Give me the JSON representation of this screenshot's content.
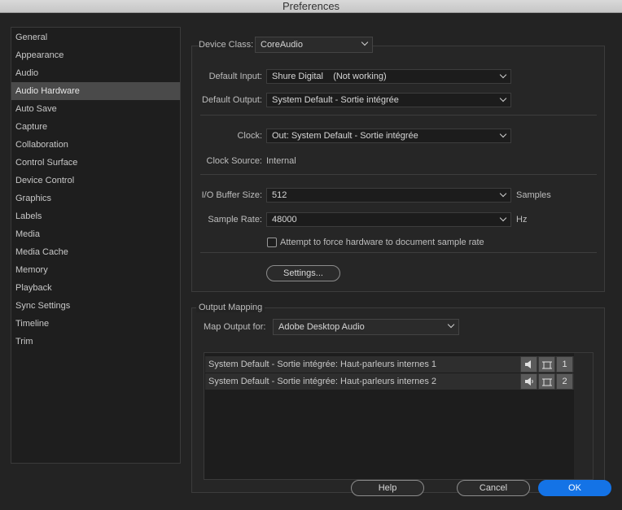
{
  "window": {
    "title": "Preferences"
  },
  "sidebar": {
    "items": [
      {
        "label": "General"
      },
      {
        "label": "Appearance"
      },
      {
        "label": "Audio"
      },
      {
        "label": "Audio Hardware"
      },
      {
        "label": "Auto Save"
      },
      {
        "label": "Capture"
      },
      {
        "label": "Collaboration"
      },
      {
        "label": "Control Surface"
      },
      {
        "label": "Device Control"
      },
      {
        "label": "Graphics"
      },
      {
        "label": "Labels"
      },
      {
        "label": "Media"
      },
      {
        "label": "Media Cache"
      },
      {
        "label": "Memory"
      },
      {
        "label": "Playback"
      },
      {
        "label": "Sync Settings"
      },
      {
        "label": "Timeline"
      },
      {
        "label": "Trim"
      }
    ],
    "selected": "Audio Hardware"
  },
  "device": {
    "class_label": "Device Class:",
    "class_value": "CoreAudio",
    "default_input_label": "Default Input:",
    "default_input_value": "Shure Digital    (Not working)",
    "default_output_label": "Default Output:",
    "default_output_value": "System Default - Sortie intégrée",
    "clock_label": "Clock:",
    "clock_value": "Out: System Default - Sortie intégrée",
    "clock_source_label": "Clock Source:",
    "clock_source_value": "Internal",
    "buffer_label": "I/O Buffer Size:",
    "buffer_value": "512",
    "buffer_unit": "Samples",
    "sample_rate_label": "Sample Rate:",
    "sample_rate_value": "48000",
    "sample_rate_unit": "Hz",
    "force_rate_label": "Attempt to force hardware to document sample rate",
    "force_rate_checked": false,
    "settings_button": "Settings..."
  },
  "output_mapping": {
    "group_label": "Output Mapping",
    "map_for_label": "Map Output for:",
    "map_for_value": "Adobe Desktop Audio",
    "rows": [
      {
        "name": "System Default - Sortie intégrée: Haut-parleurs internes 1",
        "channel": "1"
      },
      {
        "name": "System Default - Sortie intégrée: Haut-parleurs internes 2",
        "channel": "2"
      }
    ]
  },
  "footer": {
    "help": "Help",
    "cancel": "Cancel",
    "ok": "OK"
  },
  "colors": {
    "background": "#232323",
    "accent": "#1473e6",
    "selected_item": "#4a4a4a"
  }
}
